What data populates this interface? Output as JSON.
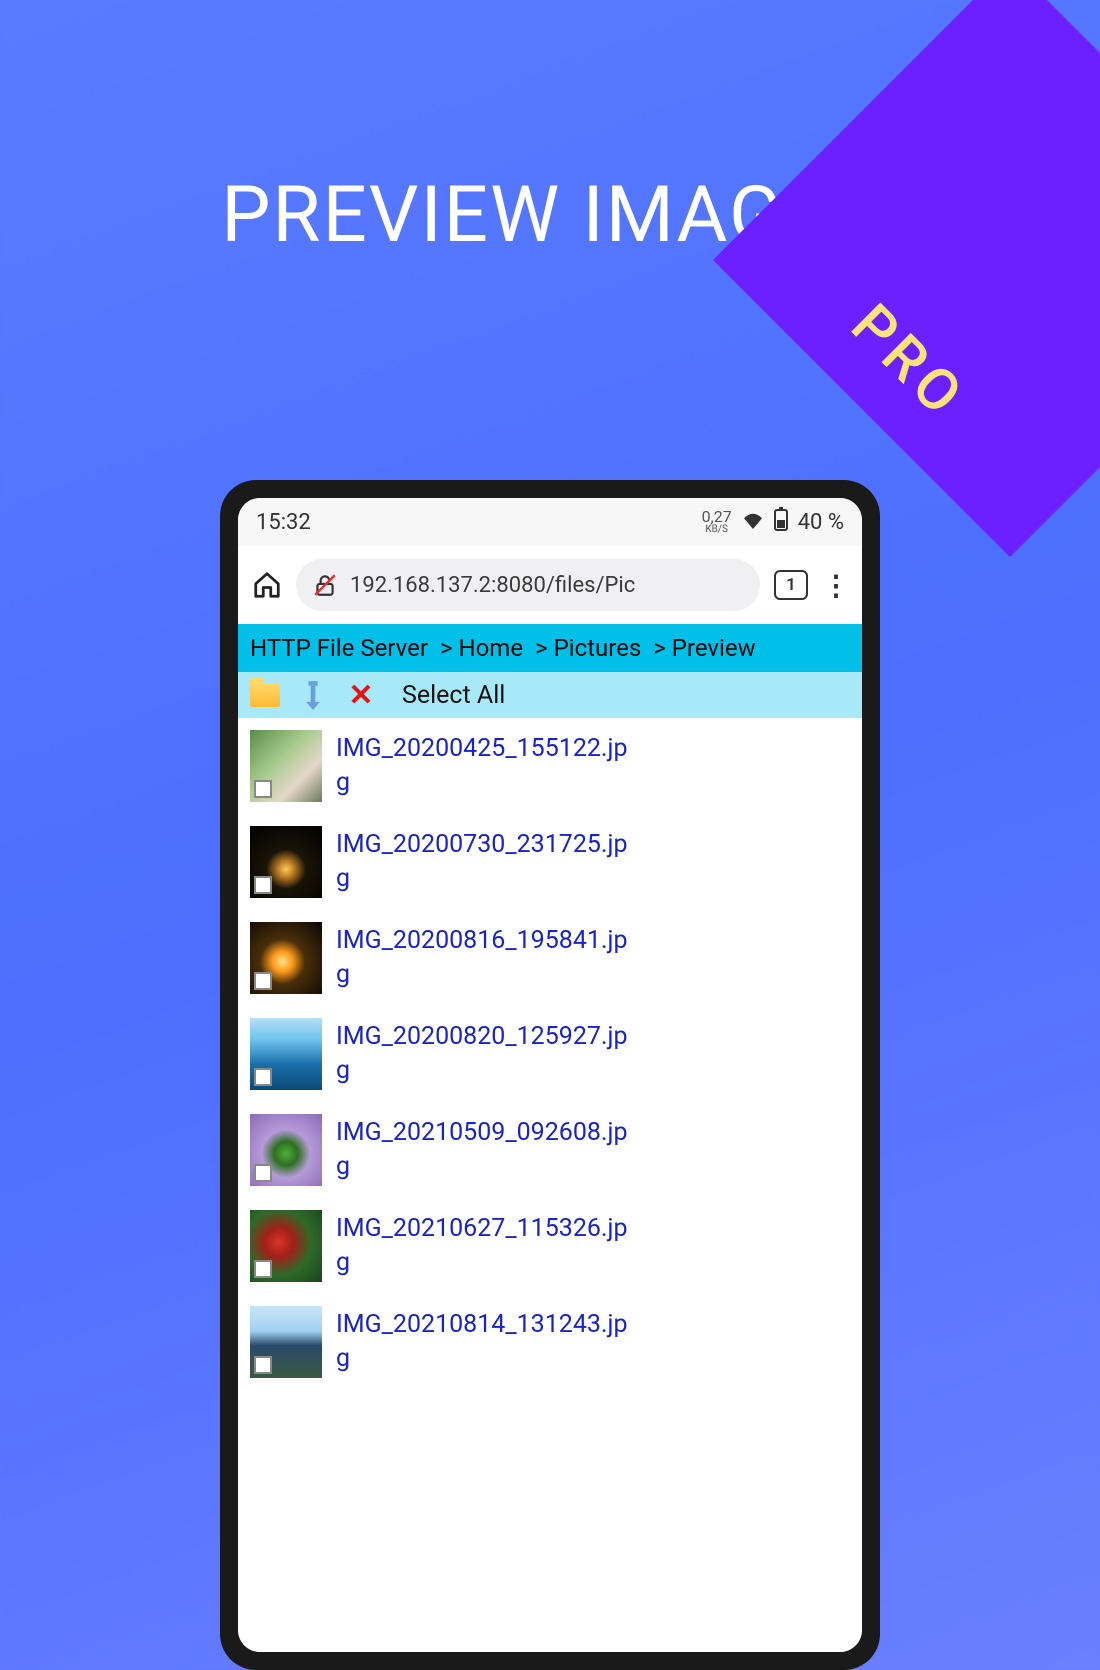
{
  "promo": {
    "ribbon": "PRO",
    "headline": "PREVIEW IMAGES"
  },
  "status": {
    "time": "15:32",
    "kbs": "0,27",
    "kbs_unit": "KB/S",
    "battery": "40 %"
  },
  "browser": {
    "url": "192.168.137.2:8080/files/Pic",
    "tab_count": "1"
  },
  "breadcrumb": {
    "root": "HTTP File Server",
    "sep": ">",
    "items": [
      "Home",
      "Pictures",
      "Preview"
    ]
  },
  "toolbar": {
    "select_all": "Select All"
  },
  "files": [
    {
      "name": "IMG_20200425_155122.jpg",
      "thumb": "thumb1"
    },
    {
      "name": "IMG_20200730_231725.jpg",
      "thumb": "thumb2"
    },
    {
      "name": "IMG_20200816_195841.jpg",
      "thumb": "thumb3"
    },
    {
      "name": "IMG_20200820_125927.jpg",
      "thumb": "thumb4"
    },
    {
      "name": "IMG_20210509_092608.jpg",
      "thumb": "thumb5"
    },
    {
      "name": "IMG_20210627_115326.jpg",
      "thumb": "thumb6"
    },
    {
      "name": "IMG_20210814_131243.jpg",
      "thumb": "thumb7"
    }
  ]
}
